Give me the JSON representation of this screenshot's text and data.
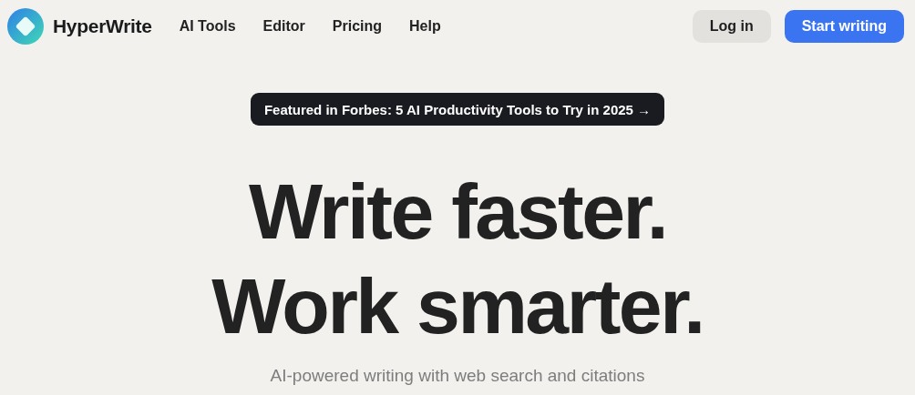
{
  "brand": {
    "name": "HyperWrite"
  },
  "nav": [
    {
      "label": "AI Tools"
    },
    {
      "label": "Editor"
    },
    {
      "label": "Pricing"
    },
    {
      "label": "Help"
    }
  ],
  "actions": {
    "login": "Log in",
    "start": "Start writing"
  },
  "banner": "Featured in Forbes: 5 AI Productivity Tools to Try in 2025 →",
  "headline": [
    "Write faster.",
    "Work smarter."
  ],
  "subtitle": "AI-powered writing with web search and citations"
}
